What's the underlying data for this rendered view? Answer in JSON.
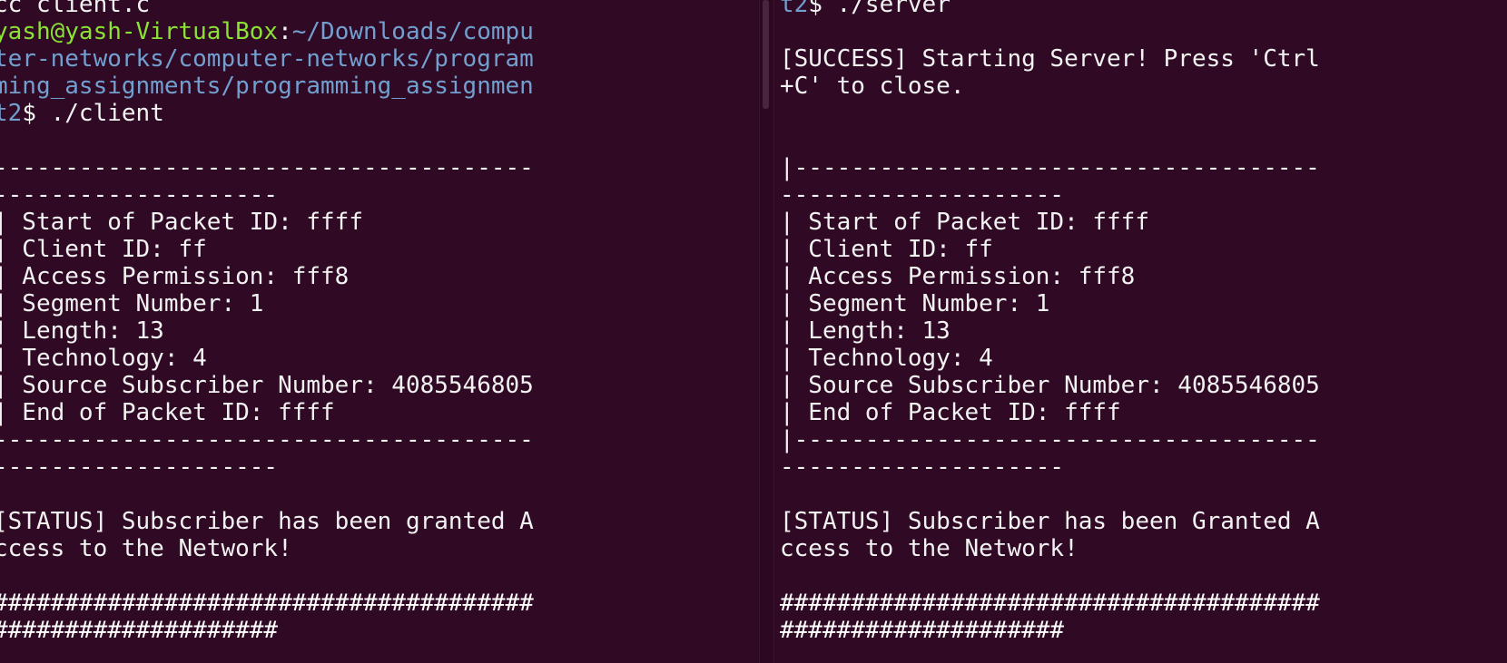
{
  "left_terminal": {
    "lines": [
      {
        "segments": [
          {
            "text": "cc client.c",
            "color": "#f2f2f2"
          }
        ]
      },
      {
        "segments": [
          {
            "text": "yash@yash-VirtualBox",
            "color": "#8ae234"
          },
          {
            "text": ":",
            "color": "#f2f2f2"
          },
          {
            "text": "~/Downloads/compu",
            "color": "#729fcf"
          }
        ]
      },
      {
        "segments": [
          {
            "text": "ter-networks/computer-networks/program",
            "color": "#729fcf"
          }
        ]
      },
      {
        "segments": [
          {
            "text": "ming_assignments/programming_assignmen",
            "color": "#729fcf"
          }
        ]
      },
      {
        "segments": [
          {
            "text": "t2",
            "color": "#729fcf"
          },
          {
            "text": "$ ./client",
            "color": "#f2f2f2"
          }
        ]
      },
      {
        "segments": [
          {
            "text": "",
            "color": "#f2f2f2"
          }
        ]
      },
      {
        "segments": [
          {
            "text": "--------------------------------------",
            "color": "#f2f2f2"
          }
        ]
      },
      {
        "segments": [
          {
            "text": "--------------------",
            "color": "#f2f2f2"
          }
        ]
      },
      {
        "segments": [
          {
            "text": "| Start of Packet ID: ffff",
            "color": "#f2f2f2"
          }
        ]
      },
      {
        "segments": [
          {
            "text": "| Client ID: ff",
            "color": "#f2f2f2"
          }
        ]
      },
      {
        "segments": [
          {
            "text": "| Access Permission: fff8",
            "color": "#f2f2f2"
          }
        ]
      },
      {
        "segments": [
          {
            "text": "| Segment Number: 1",
            "color": "#f2f2f2"
          }
        ]
      },
      {
        "segments": [
          {
            "text": "| Length: 13",
            "color": "#f2f2f2"
          }
        ]
      },
      {
        "segments": [
          {
            "text": "| Technology: 4",
            "color": "#f2f2f2"
          }
        ]
      },
      {
        "segments": [
          {
            "text": "| Source Subscriber Number: 4085546805",
            "color": "#f2f2f2"
          }
        ]
      },
      {
        "segments": [
          {
            "text": "| End of Packet ID: ffff",
            "color": "#f2f2f2"
          }
        ]
      },
      {
        "segments": [
          {
            "text": "--------------------------------------",
            "color": "#f2f2f2"
          }
        ]
      },
      {
        "segments": [
          {
            "text": "--------------------",
            "color": "#f2f2f2"
          }
        ]
      },
      {
        "segments": [
          {
            "text": "",
            "color": "#f2f2f2"
          }
        ]
      },
      {
        "segments": [
          {
            "text": "[STATUS] Subscriber has been granted A",
            "color": "#f2f2f2"
          }
        ]
      },
      {
        "segments": [
          {
            "text": "ccess to the Network!",
            "color": "#f2f2f2"
          }
        ]
      },
      {
        "segments": [
          {
            "text": "",
            "color": "#f2f2f2"
          }
        ]
      },
      {
        "segments": [
          {
            "text": "######################################",
            "color": "#ffffff"
          }
        ]
      },
      {
        "segments": [
          {
            "text": "####################",
            "color": "#ffffff"
          }
        ]
      }
    ]
  },
  "right_terminal": {
    "lines": [
      {
        "segments": [
          {
            "text": "t2",
            "color": "#729fcf"
          },
          {
            "text": "$ ./server",
            "color": "#f2f2f2"
          }
        ]
      },
      {
        "segments": [
          {
            "text": "",
            "color": "#f2f2f2"
          }
        ]
      },
      {
        "segments": [
          {
            "text": "[SUCCESS] Starting Server! Press 'Ctrl",
            "color": "#f2f2f2"
          }
        ]
      },
      {
        "segments": [
          {
            "text": "+C' to close.",
            "color": "#f2f2f2"
          }
        ]
      },
      {
        "segments": [
          {
            "text": "",
            "color": "#f2f2f2"
          }
        ]
      },
      {
        "segments": [
          {
            "text": "",
            "color": "#f2f2f2"
          }
        ]
      },
      {
        "segments": [
          {
            "text": "|-------------------------------------",
            "color": "#f2f2f2"
          }
        ]
      },
      {
        "segments": [
          {
            "text": "--------------------",
            "color": "#f2f2f2"
          }
        ]
      },
      {
        "segments": [
          {
            "text": "| Start of Packet ID: ffff",
            "color": "#f2f2f2"
          }
        ]
      },
      {
        "segments": [
          {
            "text": "| Client ID: ff",
            "color": "#f2f2f2"
          }
        ]
      },
      {
        "segments": [
          {
            "text": "| Access Permission: fff8",
            "color": "#f2f2f2"
          }
        ]
      },
      {
        "segments": [
          {
            "text": "| Segment Number: 1",
            "color": "#f2f2f2"
          }
        ]
      },
      {
        "segments": [
          {
            "text": "| Length: 13",
            "color": "#f2f2f2"
          }
        ]
      },
      {
        "segments": [
          {
            "text": "| Technology: 4",
            "color": "#f2f2f2"
          }
        ]
      },
      {
        "segments": [
          {
            "text": "| Source Subscriber Number: 4085546805",
            "color": "#f2f2f2"
          }
        ]
      },
      {
        "segments": [
          {
            "text": "| End of Packet ID: ffff",
            "color": "#f2f2f2"
          }
        ]
      },
      {
        "segments": [
          {
            "text": "|-------------------------------------",
            "color": "#f2f2f2"
          }
        ]
      },
      {
        "segments": [
          {
            "text": "--------------------",
            "color": "#f2f2f2"
          }
        ]
      },
      {
        "segments": [
          {
            "text": "",
            "color": "#f2f2f2"
          }
        ]
      },
      {
        "segments": [
          {
            "text": "[STATUS] Subscriber has been Granted A",
            "color": "#f2f2f2"
          }
        ]
      },
      {
        "segments": [
          {
            "text": "ccess to the Network!",
            "color": "#f2f2f2"
          }
        ]
      },
      {
        "segments": [
          {
            "text": "",
            "color": "#f2f2f2"
          }
        ]
      },
      {
        "segments": [
          {
            "text": "######################################",
            "color": "#ffffff"
          }
        ]
      },
      {
        "segments": [
          {
            "text": "####################",
            "color": "#ffffff"
          }
        ]
      }
    ]
  },
  "colors": {
    "background": "#300a24",
    "text": "#f2f2f2",
    "prompt_user": "#8ae234",
    "prompt_path": "#729fcf"
  }
}
